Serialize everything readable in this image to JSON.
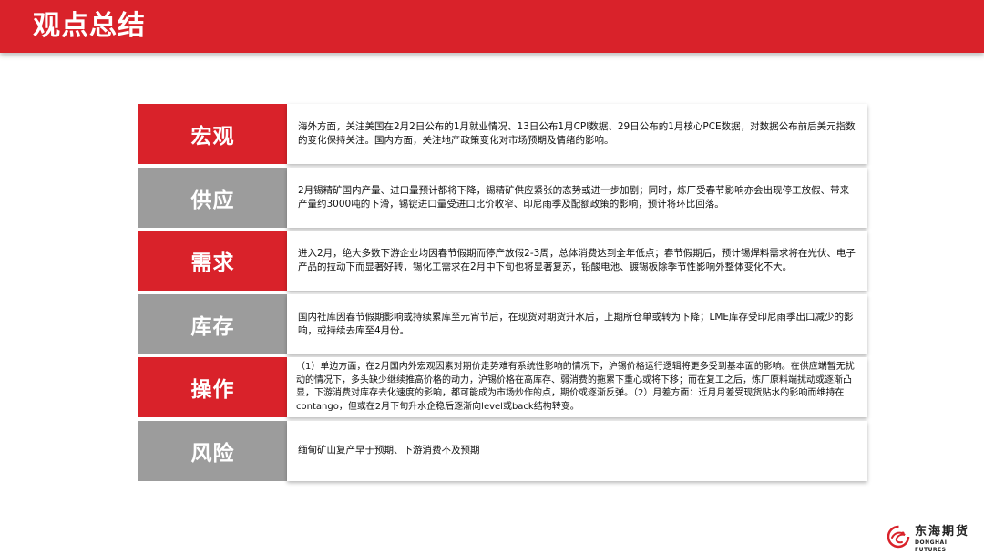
{
  "header": {
    "title": "观点总结"
  },
  "rows": [
    {
      "label": "宏观",
      "content": "海外方面，关注美国在2月2日公布的1月就业情况、13日公布1月CPI数据、29日公布的1月核心PCE数据，对数据公布前后美元指数的变化保持关注。国内方面，关注地产政策变化对市场预期及情绪的影响。"
    },
    {
      "label": "供应",
      "content": "2月锡精矿国内产量、进口量预计都将下降，锡精矿供应紧张的态势或进一步加剧；同时，炼厂受春节影响亦会出现停工放假、带来产量约3000吨的下滑，锡锭进口量受进口比价收窄、印尼雨季及配额政策的影响，预计将环比回落。"
    },
    {
      "label": "需求",
      "content": "进入2月，绝大多数下游企业均因春节假期而停产放假2-3周，总体消费达到全年低点；春节假期后，预计锡焊料需求将在光伏、电子产品的拉动下而显著好转，锡化工需求在2月中下旬也将显著复苏，铅酸电池、镀锡板除季节性影响外整体变化不大。"
    },
    {
      "label": "库存",
      "content": "国内社库因春节假期影响或持续累库至元宵节后，在现货对期货升水后，上期所仓单或转为下降；LME库存受印尼雨季出口减少的影响，或持续去库至4月份。"
    },
    {
      "label": "操作",
      "content": "（1）单边方面，在2月国内外宏观因素对期价走势难有系统性影响的情况下，沪锡价格运行逻辑将更多受到基本面的影响。在供应端暂无扰动的情况下，多头缺少继续推高价格的动力，沪锡价格在高库存、弱消费的拖累下重心或将下移；而在复工之后，炼厂原料端扰动或逐渐凸显，下游消费对库存去化速度的影响，都可能成为市场炒作的点，期价或逐渐反弹。（2）月差方面：近月月差受现货贴水的影响而维持在contango，但或在2月下旬升水企稳后逐渐向level或back结构转变。"
    },
    {
      "label": "风险",
      "content": "缅甸矿山复产早于预期、下游消费不及预期"
    }
  ],
  "logo": {
    "cn": "东海期货",
    "en": "DONGHAI FUTURES"
  },
  "colors": {
    "accent": "#d9222a",
    "gray": "#9c9c9c"
  }
}
